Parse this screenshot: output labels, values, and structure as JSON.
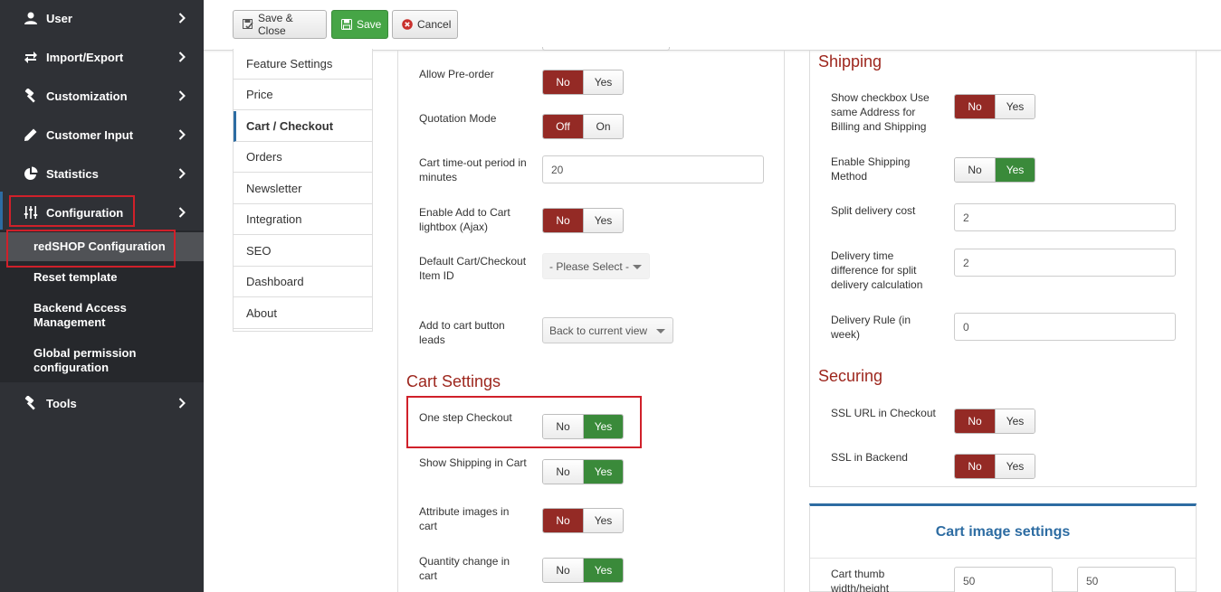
{
  "sidebar": {
    "items": [
      {
        "label": "User",
        "icon": "user-icon"
      },
      {
        "label": "Import/Export",
        "icon": "import-export-icon"
      },
      {
        "label": "Customization",
        "icon": "hammer-icon"
      },
      {
        "label": "Customer Input",
        "icon": "pencil-icon"
      },
      {
        "label": "Statistics",
        "icon": "pie-chart-icon"
      },
      {
        "label": "Configuration",
        "icon": "sliders-icon"
      },
      {
        "label": "Tools",
        "icon": "hammer-icon"
      }
    ],
    "subitems": [
      {
        "label": "redSHOP Configuration"
      },
      {
        "label": "Reset template"
      },
      {
        "label": "Backend Access Management"
      },
      {
        "label": "Global permission configuration"
      }
    ]
  },
  "toolbar": {
    "save_close": "Save & Close",
    "save": "Save",
    "cancel": "Cancel"
  },
  "tabs": [
    "Feature Settings",
    "Price",
    "Cart / Checkout",
    "Orders",
    "Newsletter",
    "Integration",
    "SEO",
    "Dashboard",
    "About"
  ],
  "active_tab": "Cart / Checkout",
  "middle": {
    "allow_preorder": {
      "label": "Allow Pre-order",
      "options": [
        "No",
        "Yes"
      ],
      "selected": "No"
    },
    "quotation_mode": {
      "label": "Quotation Mode",
      "options": [
        "Off",
        "On"
      ],
      "selected": "Off"
    },
    "cart_timeout": {
      "label": "Cart time-out period in minutes",
      "value": "20"
    },
    "add_to_cart_lightbox": {
      "label": "Enable Add to Cart lightbox (Ajax)",
      "options": [
        "No",
        "Yes"
      ],
      "selected": "No"
    },
    "default_item_id": {
      "label": "Default Cart/Checkout Item ID",
      "value": "- Please Select -"
    },
    "add_to_cart_leads": {
      "label": "Add to cart button leads",
      "value": "Back to current view"
    },
    "cart_settings_title": "Cart Settings",
    "one_step_checkout": {
      "label": "One step Checkout",
      "options": [
        "No",
        "Yes"
      ],
      "selected": "Yes"
    },
    "show_shipping": {
      "label": "Show Shipping in Cart",
      "options": [
        "No",
        "Yes"
      ],
      "selected": "Yes"
    },
    "attribute_images": {
      "label": "Attribute images in cart",
      "options": [
        "No",
        "Yes"
      ],
      "selected": "No"
    },
    "quantity_change": {
      "label": "Quantity change in cart",
      "options": [
        "No",
        "Yes"
      ],
      "selected": "Yes"
    }
  },
  "right": {
    "shipping_title": "Shipping",
    "same_address": {
      "label": "Show checkbox Use same Address for Billing and Shipping",
      "options": [
        "No",
        "Yes"
      ],
      "selected": "No"
    },
    "enable_shipping_method": {
      "label": "Enable Shipping Method",
      "options": [
        "No",
        "Yes"
      ],
      "selected": "Yes"
    },
    "split_delivery_cost": {
      "label": "Split delivery cost",
      "value": "2"
    },
    "delivery_time_diff": {
      "label": "Delivery time difference for split delivery calculation",
      "value": "2"
    },
    "delivery_rule": {
      "label": "Delivery Rule (in week)",
      "value": "0"
    },
    "securing_title": "Securing",
    "ssl_checkout": {
      "label": "SSL URL in Checkout",
      "options": [
        "No",
        "Yes"
      ],
      "selected": "No"
    },
    "ssl_backend": {
      "label": "SSL in Backend",
      "options": [
        "No",
        "Yes"
      ],
      "selected": "No"
    },
    "cart_image_title": "Cart image settings",
    "cart_thumb": {
      "label": "Cart thumb width/height",
      "width": "50",
      "height": "50"
    }
  },
  "colors": {
    "sidebar_bg": "#2f3136",
    "toggle_red": "#942a25",
    "toggle_green": "#3a8a3a",
    "section_title": "#9d261d",
    "accent_blue": "#2d6ca2",
    "highlight_red": "#d0202a"
  }
}
